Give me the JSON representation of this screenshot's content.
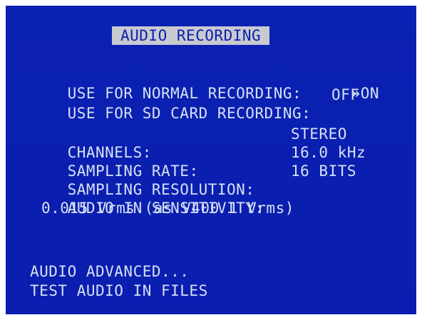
{
  "title": "AUDIO RECORDING",
  "recording": {
    "normal": {
      "label": "USE FOR NORMAL RECORDING:",
      "marker": "»",
      "value": "ON"
    },
    "sd_card": {
      "label": "USE FOR SD CARD RECORDING:",
      "value": "OFF"
    }
  },
  "settings": {
    "channels": {
      "label": "CHANNELS:",
      "value": "STEREO"
    },
    "sampling_rate": {
      "label": "SAMPLING RATE:",
      "value": "16.0 kHz"
    },
    "sampling_resolution": {
      "label": "SAMPLING RESOLUTION:",
      "value": "16 BITS"
    },
    "audio_in_sensitivity": {
      "label": "AUDIO IN SENSITIVITY:",
      "value": "0.015 Vrms (as V400 1 Vrms)"
    }
  },
  "menu": {
    "audio_advanced": "AUDIO ADVANCED...",
    "test_audio_in_files": "TEST AUDIO IN FILES"
  }
}
